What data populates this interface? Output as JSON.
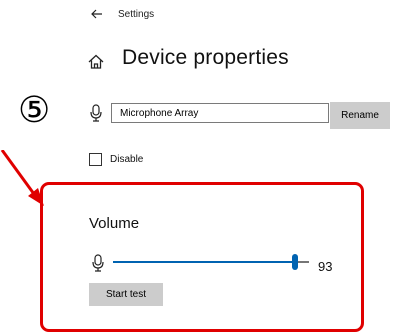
{
  "titlebar": {
    "back_icon": "back-arrow-icon",
    "app_title": "Settings"
  },
  "header": {
    "home_icon": "home-icon",
    "page_title": "Device properties"
  },
  "annotation": {
    "step_marker": "⑤",
    "highlight_color": "#e00000"
  },
  "device": {
    "icon": "microphone-icon",
    "name_value": "Microphone Array",
    "rename_label": "Rename",
    "disable_label": "Disable",
    "disable_checked": false
  },
  "volume": {
    "heading": "Volume",
    "icon": "microphone-icon",
    "value": 93,
    "value_text": "93",
    "start_test_label": "Start test"
  },
  "colors": {
    "accent": "#0063b1",
    "button_bg": "#cccccc"
  }
}
